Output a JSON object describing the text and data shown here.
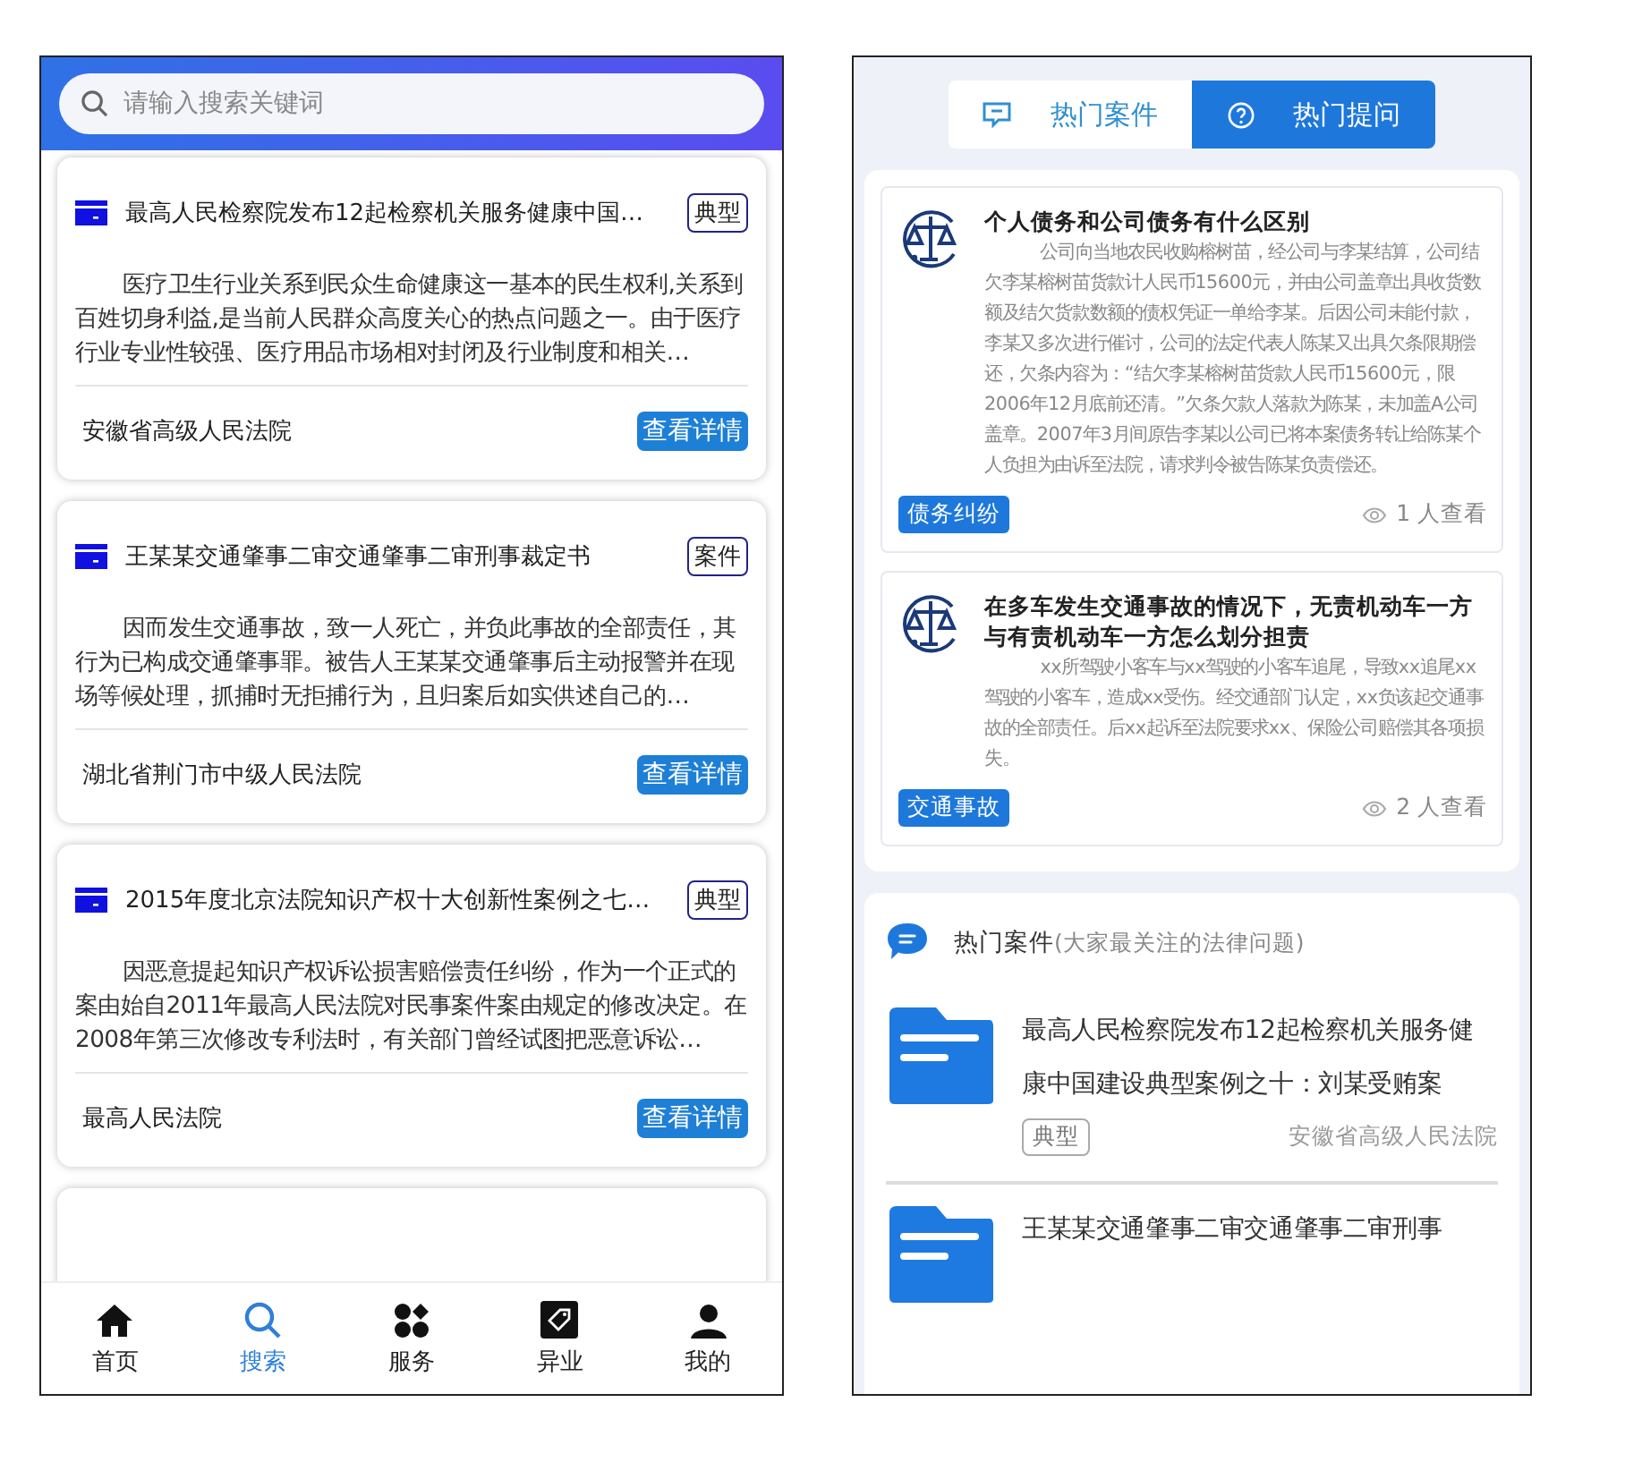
{
  "left_screen": {
    "search": {
      "placeholder": "请输入搜索关键词"
    },
    "cases": [
      {
        "title": "最高人民检察院发布12起检察机关服务健康中国…",
        "tag": "典型",
        "summary": "医疗卫生行业关系到民众生命健康这一基本的民生权利,关系到百姓切身利益,是当前人民群众高度关心的热点问题之一。由于医疗行业专业性较强、医疗用品市场相对封闭及行业制度和相关…",
        "court": "安徽省高级人民法院",
        "button": "查看详情"
      },
      {
        "title": "王某某交通肇事二审交通肇事二审刑事裁定书",
        "tag": "案件",
        "summary": "因而发生交通事故，致一人死亡，并负此事故的全部责任，其行为已构成交通肇事罪。被告人王某某交通肇事后主动报警并在现场等候处理，抓捕时无拒捕行为，且归案后如实供述自己的…",
        "court": "湖北省荆门市中级人民法院",
        "button": "查看详情"
      },
      {
        "title": "2015年度北京法院知识产权十大创新性案例之七…",
        "tag": "典型",
        "summary": "因恶意提起知识产权诉讼损害赔偿责任纠纷，作为一个正式的案由始自2011年最高人民法院对民事案件案由规定的修改决定。在2008年第三次修改专利法时，有关部门曾经试图把恶意诉讼…",
        "court": "最高人民法院",
        "button": "查看详情"
      }
    ],
    "nav": [
      {
        "kind": "home",
        "label": "首页",
        "selected": false
      },
      {
        "kind": "search",
        "label": "搜索",
        "selected": true
      },
      {
        "kind": "services",
        "label": "服务",
        "selected": false
      },
      {
        "kind": "tag",
        "label": "异业",
        "selected": false
      },
      {
        "kind": "person",
        "label": "我的",
        "selected": false
      }
    ]
  },
  "right_screen": {
    "tabs": [
      {
        "kind": "message",
        "label": "热门案件",
        "selected": false
      },
      {
        "kind": "question",
        "label": "热门提问",
        "selected": true
      }
    ],
    "questions": [
      {
        "title": "个人债务和公司债务有什么区别",
        "body": "公司向当地农民收购榕树苗，经公司与李某结算，公司结欠李某榕树苗货款计人民币15600元，并由公司盖章出具收货数额及结欠货款数额的债权凭证一单给李某。后因公司未能付款，李某又多次进行催讨，公司的法定代表人陈某又出具欠条限期偿还，欠条内容为：“结欠李某榕树苗货款人民币15600元，限2006年12月底前还清。”欠条欠款人落款为陈某，未加盖A公司盖章。2007年3月间原告李某以公司已将本案债务转让给陈某个人负担为由诉至法院，请求判令被告陈某负责偿还。",
        "tag": "债务纠纷",
        "views": "1 人查看"
      },
      {
        "title": "在多车发生交通事故的情况下，无责机动车一方与有责机动车一方怎么划分担责",
        "body": "xx所驾驶小客车与xx驾驶的小客车追尾，导致xx追尾xx驾驶的小客车，造成xx受伤。经交通部门认定，xx负该起交通事故的全部责任。后xx起诉至法院要求xx、保险公司赔偿其各项损失。",
        "tag": "交通事故",
        "views": "2 人查看"
      }
    ],
    "hot_cases": {
      "title": "热门案件",
      "subtitle": "(大家最关注的法律问题)",
      "items": [
        {
          "title": "最高人民检察院发布12起检察机关服务健康中国建设典型案例之十：刘某受贿案",
          "tag": "典型",
          "court": "安徽省高级人民法院"
        },
        {
          "title": "王某某交通肇事二审交通肇事二审刑事"
        }
      ]
    }
  }
}
